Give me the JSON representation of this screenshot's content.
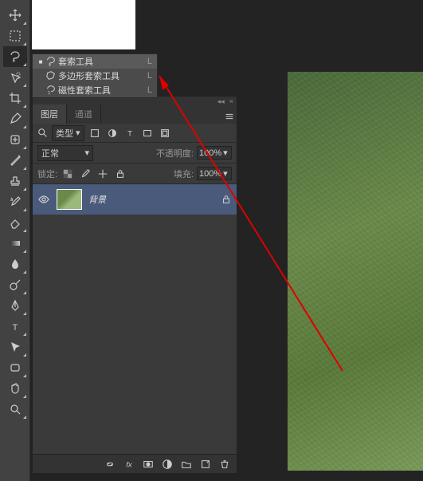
{
  "flyout": {
    "items": [
      {
        "label": "套索工具",
        "key": "L"
      },
      {
        "label": "多边形套索工具",
        "key": "L"
      },
      {
        "label": "磁性套索工具",
        "key": "L"
      }
    ]
  },
  "panel": {
    "tabs": {
      "layers": "图层",
      "channels": "通道"
    },
    "filter_label": "类型",
    "blend_mode": "正常",
    "opacity_label": "不透明度:",
    "opacity_value": "100%",
    "lock_label": "锁定:",
    "fill_label": "填充:",
    "fill_value": "100%",
    "layer_name": "背景"
  }
}
